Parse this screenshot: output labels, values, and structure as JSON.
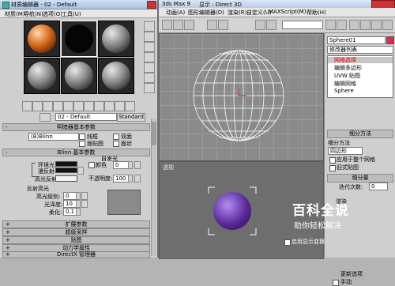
{
  "app": {
    "title_fragment": "3ds Max 9",
    "display_mode": "显示 : Direct 3D",
    "menus": [
      "动画(A)",
      "图形编辑器(D)",
      "渲染(R)",
      "自定义(U)",
      "MAXScript(M)",
      "帮助(H)"
    ],
    "viewports": {
      "bottom_label": "透视"
    },
    "object_name": "Sphere01",
    "modifier_list_label": "修改器列表",
    "stack_items": [
      "网格选择",
      "编辑多边形",
      "UVW 贴图",
      "编辑网格",
      "Sphere"
    ],
    "bottom_checkbox": "启用显示变换",
    "smoothing_rollout": "细分方法",
    "smoothing_label": "细分方法",
    "smoothing_value": "四边形",
    "apply_whole": "应用于整个网格",
    "old_style": "旧式贴图",
    "subdiv_amount": "细分量",
    "iterations_label": "迭代次数:",
    "iterations_value": "0",
    "render_rollout": "渲染",
    "update_label": "更新选项",
    "update_value": "手动"
  },
  "material_editor": {
    "title": "材质编辑器 - 02 - Default",
    "menus": [
      "材质(M)",
      "导航(N)",
      "选项(O)",
      "工具(U)"
    ],
    "material_name": "02 - Default",
    "material_type": "Standard",
    "shader_rollout": "明暗器基本参数",
    "shader_value": "(B)Blinn",
    "wire": "线框",
    "two_sided": "双面",
    "face_map": "面贴图",
    "faceted": "面状",
    "blinn_rollout": "Blinn 基本参数",
    "self_illum": "自发光",
    "color": "颜色",
    "color_value": "0",
    "ambient": "环境光:",
    "diffuse": "漫反射:",
    "specular": "高光反射:",
    "opacity": "不透明度:",
    "opacity_value": "100",
    "spec_highlights": "反射高光",
    "spec_level": "高光级别:",
    "spec_level_value": "0",
    "glossiness": "光泽度:",
    "glossiness_value": "10",
    "soften": "柔化:",
    "soften_value": "0.1",
    "rollouts": [
      "扩展参数",
      "超级采样",
      "贴图",
      "动力学属性",
      "DirectX 管理器"
    ]
  },
  "watermark": {
    "brand": "百科全说",
    "slogan": "助你轻松解决"
  },
  "colors": {
    "orange_material": "#d86a1c",
    "purple_material": "#5a2a9a",
    "panel_bg": "#cfcfcf",
    "titlebar": "#b9cce6"
  }
}
